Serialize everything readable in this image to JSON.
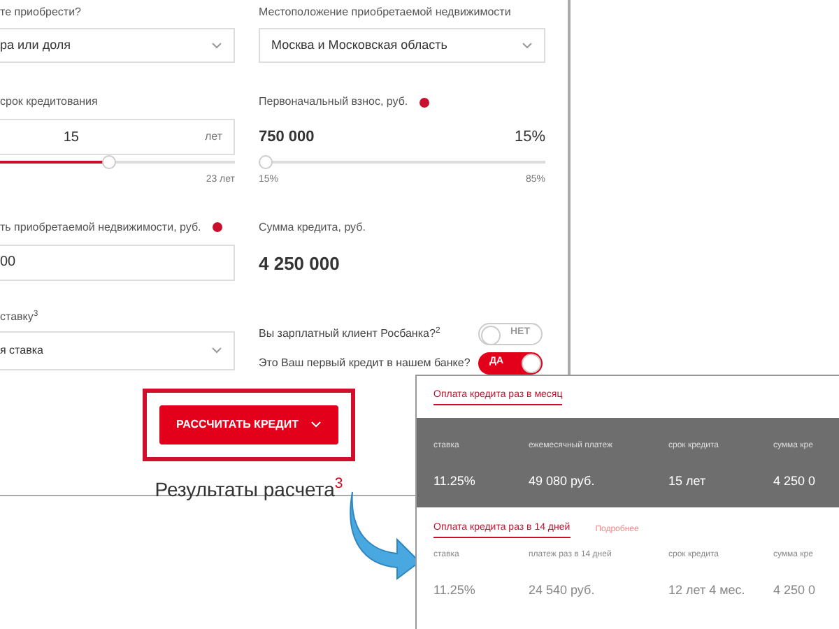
{
  "form": {
    "property_type": {
      "label": "те приобрести?",
      "value": "ра или доля"
    },
    "location": {
      "label": "Местоположение приобретаемой недвижимости",
      "value": "Москва и Московская область"
    },
    "term": {
      "label": "срок кредитования",
      "value": "15",
      "unit": "лет",
      "level": 0.46,
      "max_label": "23 лет"
    },
    "down_payment": {
      "label": "Первоначальный взнос, руб.",
      "value": "750 000",
      "percent": "15%",
      "level": 0,
      "min_label": "15%",
      "max_label": "85%"
    },
    "property_cost": {
      "label": "ть приобретаемой недвижимости, руб.",
      "value": "00"
    },
    "loan_amount": {
      "label": "Сумма кредита, руб.",
      "value": "4 250 000"
    },
    "rate": {
      "label": "ставку$^{3}$",
      "value": "я ставка"
    },
    "toggles": [
      {
        "label": "Вы зарплатный клиент Росбанка?$^{2}$",
        "text": "НЕТ",
        "on": false
      },
      {
        "label": "Это Ваш первый кредит в нашем банке?",
        "text": "ДА",
        "on": true
      }
    ],
    "calculate_button": "РАССЧИТАТЬ КРЕДИТ",
    "results_title": "Результаты расчета$^{3}$"
  },
  "results": {
    "monthly": {
      "tab": "Оплата кредита раз в месяц",
      "columns": [
        {
          "label": "ставка",
          "value": "11.25%"
        },
        {
          "label": "ежемесячный платеж",
          "value": "49 080 руб."
        },
        {
          "label": "срок кредита",
          "value": "15 лет"
        },
        {
          "label": "сумма кре",
          "value": "4 250 0"
        }
      ]
    },
    "biweekly": {
      "tab": "Оплата кредита раз в 14 дней",
      "link": "Подробнее",
      "columns": [
        {
          "label": "ставка",
          "value": "11.25%"
        },
        {
          "label": "платеж раз в 14 дней",
          "value": "24 540 руб."
        },
        {
          "label": "срок кредита",
          "value": "12 лет 4 мес."
        },
        {
          "label": "сумма кре",
          "value": "4 250 0"
        }
      ]
    }
  }
}
